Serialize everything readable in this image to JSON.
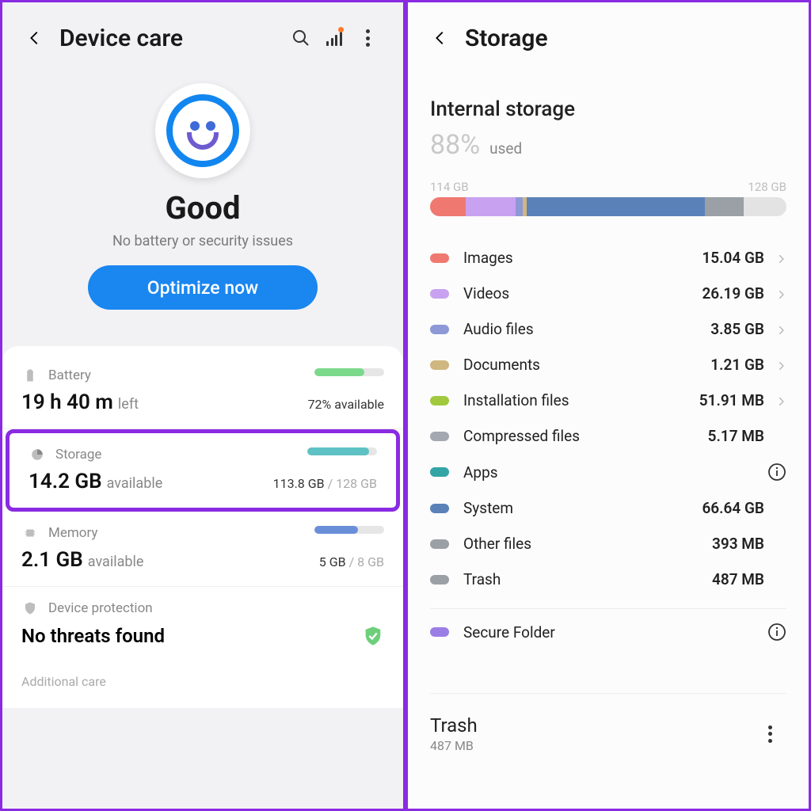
{
  "left": {
    "title": "Device care",
    "status_title": "Good",
    "status_sub": "No battery or security issues",
    "optimize_btn": "Optimize now",
    "battery": {
      "label": "Battery",
      "value": "19 h 40 m",
      "value_suffix": "left",
      "available": "72% available",
      "fill_pct": 72,
      "fill_color": "#7bd98c"
    },
    "storage": {
      "label": "Storage",
      "value": "14.2 GB",
      "value_suffix": "available",
      "used": "113.8 GB",
      "total": "128 GB",
      "fill_pct": 89,
      "fill_color": "#5ec1c3"
    },
    "memory": {
      "label": "Memory",
      "value": "2.1 GB",
      "value_suffix": "available",
      "used": "5 GB",
      "total": "8 GB",
      "fill_pct": 62,
      "fill_color": "#6a8fd8"
    },
    "protection": {
      "label": "Device protection",
      "value": "No threats found"
    },
    "additional": "Additional care"
  },
  "right": {
    "title": "Storage",
    "subtitle": "Internal storage",
    "pct": "88%",
    "used_label": "used",
    "bar_left": "114 GB",
    "bar_right": "128 GB",
    "segments": [
      {
        "color": "#ef7971",
        "pct": 10
      },
      {
        "color": "#c8a2f0",
        "pct": 14
      },
      {
        "color": "#8c99d6",
        "pct": 2
      },
      {
        "color": "#d0b77f",
        "pct": 1
      },
      {
        "color": "#5b82b8",
        "pct": 50
      },
      {
        "color": "#9aa0a6",
        "pct": 11
      }
    ],
    "categories": [
      {
        "name": "Images",
        "size": "15.04 GB",
        "color": "#ef7971",
        "action": "chevron"
      },
      {
        "name": "Videos",
        "size": "26.19 GB",
        "color": "#c8a2f0",
        "action": "chevron"
      },
      {
        "name": "Audio files",
        "size": "3.85 GB",
        "color": "#8c99d6",
        "action": "chevron"
      },
      {
        "name": "Documents",
        "size": "1.21 GB",
        "color": "#d0b77f",
        "action": "chevron"
      },
      {
        "name": "Installation files",
        "size": "51.91 MB",
        "color": "#a0c93e",
        "action": "chevron"
      },
      {
        "name": "Compressed files",
        "size": "5.17 MB",
        "color": "#a4a9b0",
        "action": "none"
      },
      {
        "name": "Apps",
        "size": "",
        "color": "#34a5a6",
        "action": "info"
      },
      {
        "name": "System",
        "size": "66.64 GB",
        "color": "#5b82b8",
        "action": "none"
      },
      {
        "name": "Other files",
        "size": "393 MB",
        "color": "#9aa0a6",
        "action": "none"
      },
      {
        "name": "Trash",
        "size": "487 MB",
        "color": "#9aa0a6",
        "action": "none"
      }
    ],
    "secure_folder": "Secure Folder",
    "secure_folder_color": "#9b7de6",
    "trash": {
      "title": "Trash",
      "size": "487 MB"
    }
  }
}
